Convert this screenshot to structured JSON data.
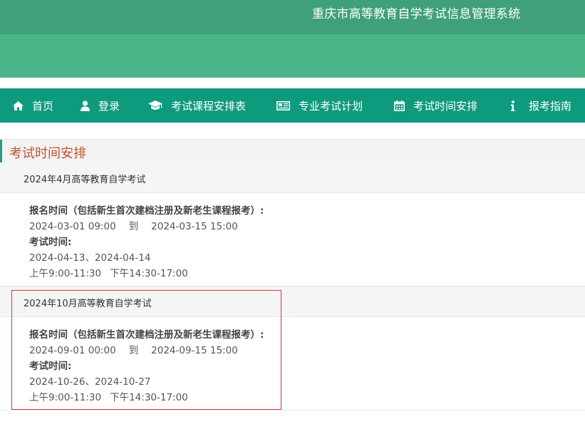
{
  "header": {
    "title": "重庆市高等教育自学考试信息管理系统"
  },
  "nav": {
    "items": [
      {
        "label": "首页",
        "icon": "home-icon"
      },
      {
        "label": "登录",
        "icon": "user-icon"
      },
      {
        "label": "考试课程安排表",
        "icon": "graduation-cap-icon"
      },
      {
        "label": "专业考试计划",
        "icon": "newspaper-icon"
      },
      {
        "label": "考试时间安排",
        "icon": "calendar-icon"
      },
      {
        "label": "报考指南",
        "icon": "info-icon"
      }
    ]
  },
  "section": {
    "title": "考试时间安排"
  },
  "exams": [
    {
      "title": "2024年4月高等教育自学考试",
      "reg_label": "报名时间（包括新生首次建档注册及新老生课程报考）:",
      "reg_start": "2024-03-01 09:00",
      "to": "到",
      "reg_end": "2024-03-15 15:00",
      "exam_label": "考试时间:",
      "exam_dates": "2024-04-13、2024-04-14",
      "morning": "上午9:00-11:30",
      "afternoon": "下午14:30-17:00"
    },
    {
      "title": "2024年10月高等教育自学考试",
      "reg_label": "报名时间（包括新生首次建档注册及新老生课程报考）:",
      "reg_start": "2024-09-01 00:00",
      "to": "到",
      "reg_end": "2024-09-15 15:00",
      "exam_label": "考试时间:",
      "exam_dates": "2024-10-26、2024-10-27",
      "morning": "上午9:00-11:30",
      "afternoon": "下午14:30-17:00"
    }
  ],
  "colors": {
    "header": "#4bb489",
    "nav": "#0e9a7d",
    "section_title": "#c0532f",
    "highlight": "#d9343a"
  }
}
